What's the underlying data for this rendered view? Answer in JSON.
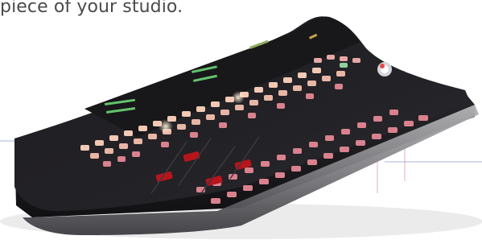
{
  "caption": {
    "text": "piece of your studio."
  },
  "photo": {
    "subject": "radio broadcast mixing console",
    "colors": {
      "body": "#1b1a1d",
      "key_light": "#f2c9b4",
      "key_pink": "#d9828e",
      "fader_red": "#b8141c",
      "meter_green": "#63c36b",
      "trim_metal": "#8b8b8e",
      "guide_line": "#a9b5d8"
    }
  }
}
